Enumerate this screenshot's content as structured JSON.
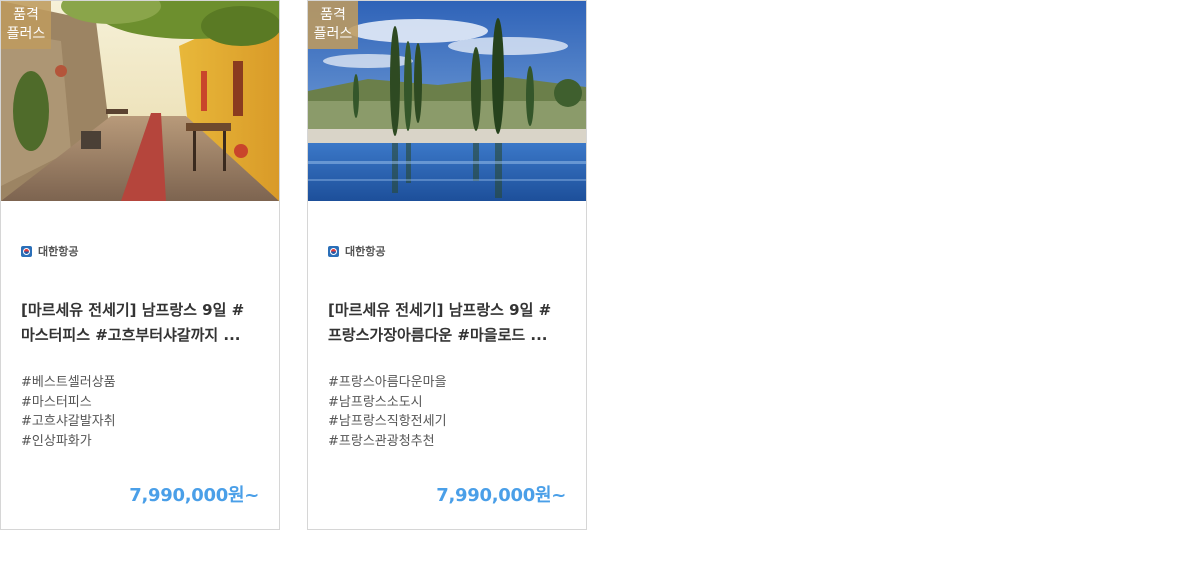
{
  "colors": {
    "price": "#4a9fe8",
    "badge_bg": "#be9b5f",
    "border": "#d6d6d6"
  },
  "cards": [
    {
      "badge_line1": "품격",
      "badge_line2": "플러스",
      "image": "provence-village-alley-photo",
      "airline": "대한항공",
      "title_line1": "[마르세유 전세기] 남프랑스 9일 #",
      "title_line2": "마스터피스 #고흐부터샤갈까지 ...",
      "tags": [
        "#베스트셀러상품",
        "#마스터피스",
        "#고흐샤갈발자취",
        "#인상파화가"
      ],
      "price": "7,990,000원~"
    },
    {
      "badge_line1": "품격",
      "badge_line2": "플러스",
      "image": "cypress-pool-resort-photo",
      "airline": "대한항공",
      "title_line1": "[마르세유 전세기] 남프랑스 9일 #",
      "title_line2": "프랑스가장아름다운 #마을로드 ...",
      "tags": [
        "#프랑스아름다운마을",
        "#남프랑스소도시",
        "#남프랑스직항전세기",
        "#프랑스관광청추천"
      ],
      "price": "7,990,000원~"
    }
  ]
}
